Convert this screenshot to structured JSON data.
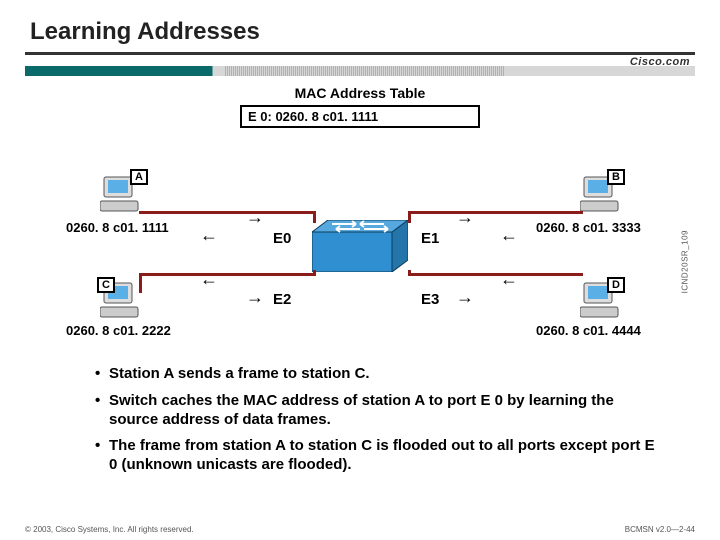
{
  "title": "Learning Addresses",
  "logo": "Cisco.com",
  "mac_table": {
    "title": "MAC Address Table",
    "entry": "E 0:  0260. 8 c01. 1111"
  },
  "stations": {
    "a": {
      "label": "A",
      "mac": "0260. 8 c01. 1111"
    },
    "b": {
      "label": "B",
      "mac": "0260. 8 c01. 3333"
    },
    "c": {
      "label": "C",
      "mac": "0260. 8 c01. 2222"
    },
    "d": {
      "label": "D",
      "mac": "0260. 8 c01. 4444"
    }
  },
  "ports": {
    "e0": "E0",
    "e1": "E1",
    "e2": "E2",
    "e3": "E3"
  },
  "side_ref": "ICND20SR_109",
  "bullets": [
    "Station A sends a frame to station C.",
    "Switch caches the MAC address of station A to port E 0 by learning the source address of data frames.",
    "The frame from station A to station C is flooded out to all ports except port E 0 (unknown unicasts are flooded)."
  ],
  "footer": {
    "left": "© 2003, Cisco Systems, Inc. All rights reserved.",
    "right": "BCMSN v2.0—2-44"
  }
}
